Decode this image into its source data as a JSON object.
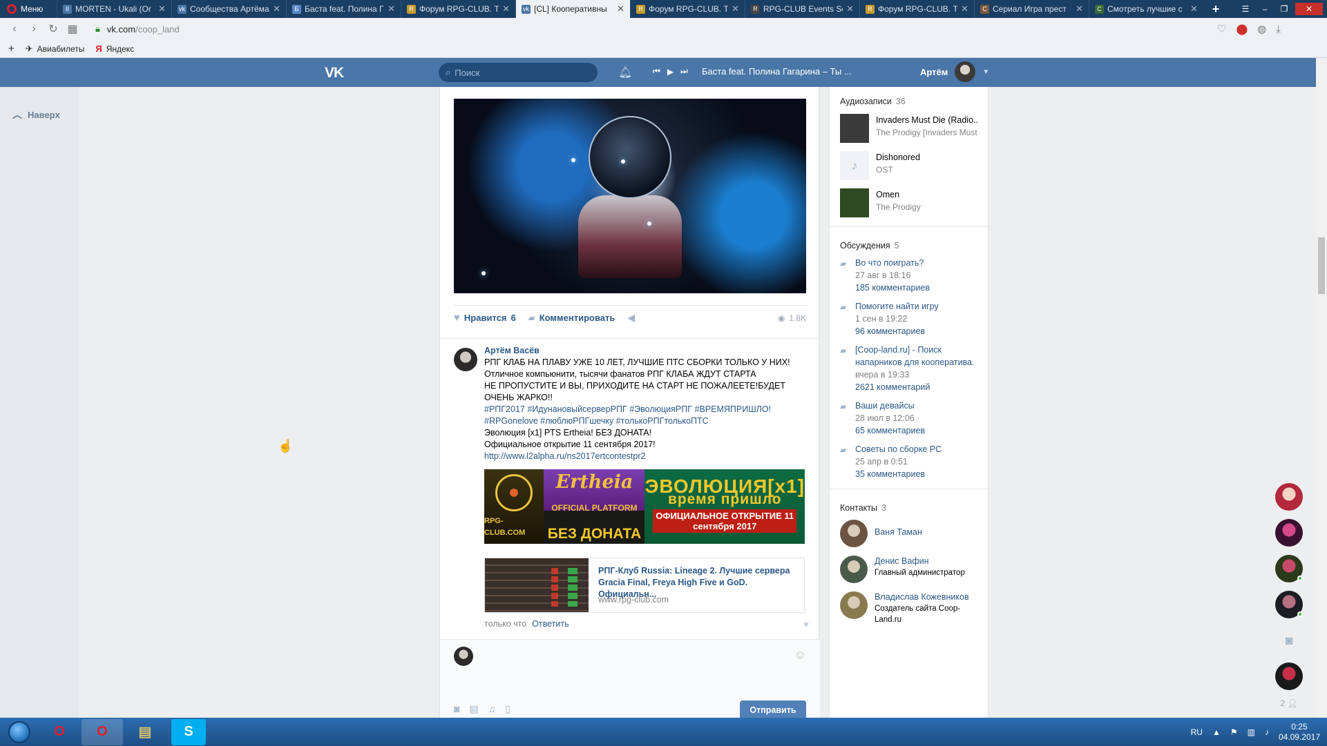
{
  "browser": {
    "menu_label": "Меню",
    "tabs": [
      {
        "title": "MORTEN - Ukali (Or",
        "color": "#4a76a8",
        "glyph": "II"
      },
      {
        "title": "Сообщества Артёма",
        "color": "#4a76a8",
        "glyph": "vk"
      },
      {
        "title": "Баста feat. Полина Г",
        "color": "#5a87c6",
        "glyph": "Б"
      },
      {
        "title": "Форум RPG-CLUB. Т",
        "color": "#c69a2b",
        "glyph": "R"
      },
      {
        "title": "[CL] Кооперативны",
        "color": "#4a76a8",
        "glyph": "vk",
        "active": true
      },
      {
        "title": "Форум RPG-CLUB. Т",
        "color": "#c69a2b",
        "glyph": "R"
      },
      {
        "title": "RPG-CLUB Events Sc",
        "color": "#444444",
        "glyph": "R"
      },
      {
        "title": "Форум RPG-CLUB. Т",
        "color": "#c69a2b",
        "glyph": "R"
      },
      {
        "title": "Сериал Игра прест",
        "color": "#7a5a3a",
        "glyph": "С"
      },
      {
        "title": "Смотреть лучшие с",
        "color": "#3a6a3a",
        "glyph": "С"
      }
    ],
    "url_host": "vk.com",
    "url_path": "/coop_land",
    "bookmarks": [
      {
        "label": "Авиабилеты",
        "icon": "plane-icon"
      },
      {
        "label": "Яндекс",
        "icon": "yandex-icon"
      }
    ]
  },
  "vk": {
    "search_placeholder": "Поиск",
    "now_playing": "Баста feat. Полина Гагарина – Ты ...",
    "user_name": "Артём",
    "to_top": "Наверх"
  },
  "post": {
    "like_label": "Нравится",
    "like_count": "6",
    "comment_label": "Комментировать",
    "views": "1.8K"
  },
  "comment": {
    "author": "Артём Васёв",
    "lines": [
      "РПГ КЛАБ НА ПЛАВУ УЖЕ 10 ЛЕТ, ЛУЧШИЕ ПТС СБОРКИ ТОЛЬКО У НИХ!",
      "Отличное компьюнити, тысячи фанатов РПГ КЛАБА ЖДУТ СТАРТА",
      "НЕ ПРОПУСТИТЕ И ВЫ, ПРИХОДИТЕ НА СТАРТ НЕ ПОЖАЛЕЕТЕ!БУДЕТ ОЧЕНЬ ЖАРКО!!"
    ],
    "hashtags_1": "#РПГ2017 #ИдунановыйсерверРПГ #ЭволюцияРПГ #ВРЕМЯПРИШЛО!",
    "hashtags_2": "#RPGonelove #люблюРПГшечку #толькоРПГтолькоПТС",
    "line_evolution": "Эволюция [x1] PTS Ertheia! БЕЗ ДОНАТА!",
    "line_opening": "Официальное открытие 11 сентября 2017!",
    "link": "http://www.l2alpha.ru/ns2017ertcontestpr2",
    "banner": {
      "logo_text": "RPG-CLUB.COM",
      "ertheia": "Ertheia",
      "official": "OFFICIAL PLATFORM",
      "no_donate": "БЕЗ ДОНАТА",
      "evolution": "ЭВОЛЮЦИЯ[x1]",
      "time_has_come": "время пришло",
      "opening": "ОФИЦИАЛЬНОЕ ОТКРЫТИЕ 11 сентября 2017"
    },
    "card_title": "РПГ-Клуб Russia: Lineage 2. Лучшие сервера Gracia Final, Freya High Five и GoD. Официальн...",
    "card_domain": "www.rpg-club.com",
    "time": "только что",
    "reply_label": "Ответить"
  },
  "reply": {
    "send_label": "Отправить"
  },
  "sidebar": {
    "audio_title": "Аудиозаписи",
    "audio_count": "36",
    "audio": [
      {
        "title": "Invaders Must Die (Radio...",
        "artist": "The Prodigy [Invaders Must",
        "cover": "#3a3a3a"
      },
      {
        "title": "Dishonored",
        "artist": "OST",
        "cover": "#f0f2f5"
      },
      {
        "title": "Omen",
        "artist": "The Prodigy",
        "cover": "#2e4a22"
      }
    ],
    "disc_title": "Обсуждения",
    "disc_count": "5",
    "discussions": [
      {
        "title": "Во что поиграть?",
        "date": "27 авг в 18:16",
        "count": "185 комментариев"
      },
      {
        "title": "Помогите найти игру",
        "date": "1 сен в 19:22",
        "count": "96 комментариев"
      },
      {
        "title": "[Coop-land.ru] - Поиск напарников для кооператива.",
        "date": "вчера в 19:33",
        "count": "2621 комментарий"
      },
      {
        "title": "Ваши девайсы",
        "date": "28 июл в 12:06",
        "count": "65 комментариев"
      },
      {
        "title": "Советы по сборке PC",
        "date": "25 апр в 0:51",
        "count": "35 комментариев"
      }
    ],
    "contacts_title": "Контакты",
    "contacts_count": "3",
    "contacts": [
      {
        "name": "Ваня Таман",
        "role": "",
        "color": "#6b5440"
      },
      {
        "name": "Денис Вафин",
        "role": "Главный администратор",
        "color": "#4a5a4a"
      },
      {
        "name": "Владислав Кожевников",
        "role": "Создатель сайта Coop-Land.ru",
        "color": "#8a7a50"
      }
    ]
  },
  "dock": {
    "count": "2"
  },
  "taskbar": {
    "lang": "RU",
    "time": "0:25",
    "date": "04.09.2017"
  }
}
